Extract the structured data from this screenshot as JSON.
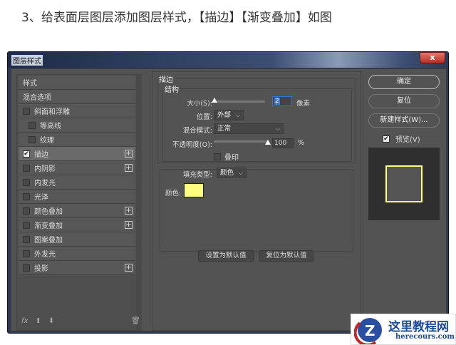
{
  "caption": "3、给表面层图层添加图层样式，【描边】【渐变叠加】如图",
  "window": {
    "title": "图层样式",
    "close": "x"
  },
  "left": {
    "items": [
      {
        "label": "样式",
        "checkbox": false,
        "checked": false,
        "plus": false,
        "indent": false
      },
      {
        "label": "混合选项",
        "checkbox": false,
        "checked": false,
        "plus": false,
        "indent": false
      },
      {
        "label": "斜面和浮雕",
        "checkbox": true,
        "checked": false,
        "plus": false,
        "indent": false
      },
      {
        "label": "等高线",
        "checkbox": true,
        "checked": false,
        "plus": false,
        "indent": true
      },
      {
        "label": "纹理",
        "checkbox": true,
        "checked": false,
        "plus": false,
        "indent": true
      },
      {
        "label": "描边",
        "checkbox": true,
        "checked": true,
        "plus": true,
        "indent": false,
        "selected": true
      },
      {
        "label": "内阴影",
        "checkbox": true,
        "checked": false,
        "plus": true,
        "indent": false
      },
      {
        "label": "内发光",
        "checkbox": true,
        "checked": false,
        "plus": false,
        "indent": false
      },
      {
        "label": "光泽",
        "checkbox": true,
        "checked": false,
        "plus": false,
        "indent": false
      },
      {
        "label": "颜色叠加",
        "checkbox": true,
        "checked": false,
        "plus": true,
        "indent": false
      },
      {
        "label": "渐变叠加",
        "checkbox": true,
        "checked": false,
        "plus": true,
        "indent": false
      },
      {
        "label": "图案叠加",
        "checkbox": true,
        "checked": false,
        "plus": false,
        "indent": false
      },
      {
        "label": "外发光",
        "checkbox": true,
        "checked": false,
        "plus": false,
        "indent": false
      },
      {
        "label": "投影",
        "checkbox": true,
        "checked": false,
        "plus": true,
        "indent": false
      }
    ],
    "fx": "fx"
  },
  "stroke": {
    "legend": "描边",
    "structure": "结构",
    "size_label": "大小(S):",
    "size_value": "2",
    "size_unit": "像素",
    "size_fraction": 0.01,
    "position_label": "位置:",
    "position": "外部",
    "blend_label": "混合模式:",
    "blend": "正常",
    "opacity_label": "不透明度(O):",
    "opacity": "100",
    "opacity_unit": "%",
    "opacity_fraction": 1.0,
    "overprint": "叠印",
    "fill_type_label": "填充类型:",
    "fill_type": "颜色",
    "color_label": "颜色:",
    "color": "#ffff80",
    "set_default": "设置为默认值",
    "reset_default": "复位为默认值"
  },
  "right": {
    "ok": "确定",
    "reset": "复位",
    "new_style": "新建样式(W)...",
    "preview": "预览(V)"
  },
  "logo": {
    "name": "这里教程网",
    "url": "herecours.com"
  }
}
